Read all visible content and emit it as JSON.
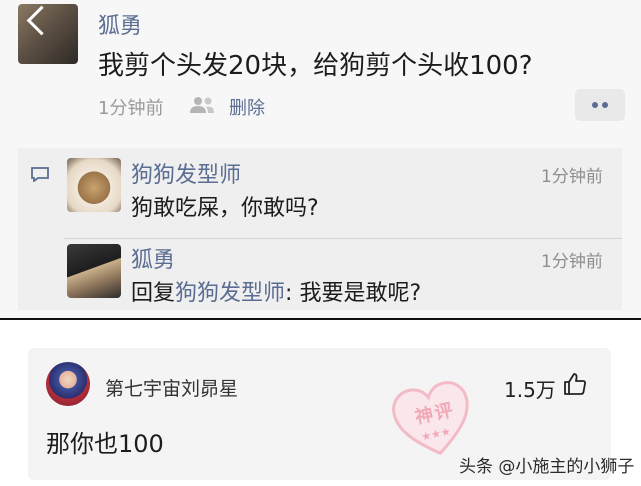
{
  "post": {
    "author": "狐勇",
    "text": "我剪个头发20块，给狗剪个头收100?",
    "time": "1分钟前",
    "delete_label": "删除",
    "visibility_icon": "friends-icon",
    "more_icon": "more-icon"
  },
  "comments": [
    {
      "author": "狗狗发型师",
      "text": "狗敢吃屎，你敢吗?",
      "time": "1分钟前"
    },
    {
      "author": "狐勇",
      "reply_prefix": "回复",
      "reply_to": "狗狗发型师",
      "separator": ": ",
      "text": "我要是敢呢?",
      "time": "1分钟前"
    }
  ],
  "featured_comment": {
    "author": "第七宇宙刘昴星",
    "likes": "1.5万",
    "text": "那你也100"
  },
  "stamp": {
    "line1": "神",
    "line2": "评",
    "stars": "★★★",
    "color": "#f3a8b6"
  },
  "watermark": "头条 @小施主的小狮子",
  "colors": {
    "link": "#5b6d92",
    "text": "#1c1c1c",
    "muted": "#9a9a9a"
  }
}
